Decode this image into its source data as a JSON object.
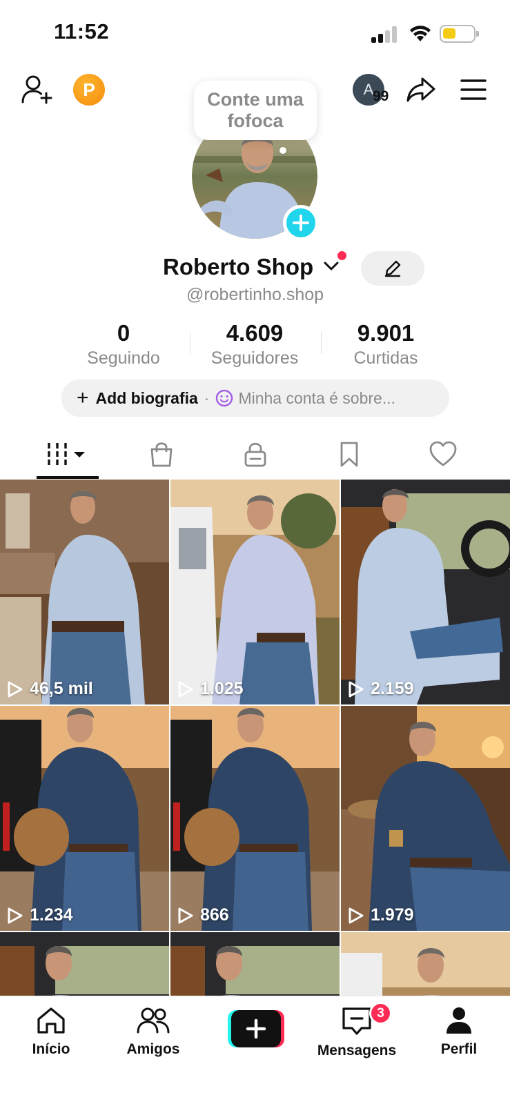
{
  "status_bar": {
    "time": "11:52",
    "signal_bars_active": 2,
    "battery_level": 0.35,
    "battery_color": "#f5cc15"
  },
  "top_bar": {
    "add_friend_icon": "person-plus-icon",
    "coin_letter": "P",
    "notification_avatar_letter": "A",
    "notification_count": "99",
    "share_icon": "share-arrow-icon",
    "menu_icon": "hamburger-icon"
  },
  "profile": {
    "note_bubble": "Conte uma fofoca",
    "display_name": "Roberto Shop",
    "username": "@robertinho.shop",
    "edit_icon": "pencil-icon"
  },
  "stats": [
    {
      "value": "0",
      "label": "Seguindo"
    },
    {
      "value": "4.609",
      "label": "Seguidores"
    },
    {
      "value": "9.901",
      "label": "Curtidas"
    }
  ],
  "bio": {
    "add_label": "Add biografia",
    "separator": "·",
    "hint": "Minha conta é sobre..."
  },
  "tabs": [
    {
      "icon": "grid-icon",
      "active": true
    },
    {
      "icon": "shopping-bag-icon",
      "active": false
    },
    {
      "icon": "lock-icon",
      "active": false
    },
    {
      "icon": "bookmark-icon",
      "active": false
    },
    {
      "icon": "heart-icon",
      "active": false
    }
  ],
  "videos": [
    {
      "views": "46,5 mil"
    },
    {
      "views": "1.025"
    },
    {
      "views": "2.159"
    },
    {
      "views": "1.234"
    },
    {
      "views": "866"
    },
    {
      "views": "1.979"
    },
    {
      "views": ""
    },
    {
      "views": ""
    },
    {
      "views": ""
    }
  ],
  "bottom_nav": {
    "items": [
      {
        "label": "Início",
        "icon": "home-icon"
      },
      {
        "label": "Amigos",
        "icon": "friends-icon"
      },
      {
        "label": "",
        "icon": "plus-icon"
      },
      {
        "label": "Mensagens",
        "icon": "inbox-icon"
      },
      {
        "label": "Perfil",
        "icon": "profile-icon"
      }
    ],
    "messages_badge": "3"
  },
  "colors": {
    "accent_red": "#fe2c55",
    "accent_cyan": "#25f4ee",
    "add_badge": "#20d5ec",
    "coin": "#f79d12",
    "muted_text": "#8a8a8a"
  }
}
